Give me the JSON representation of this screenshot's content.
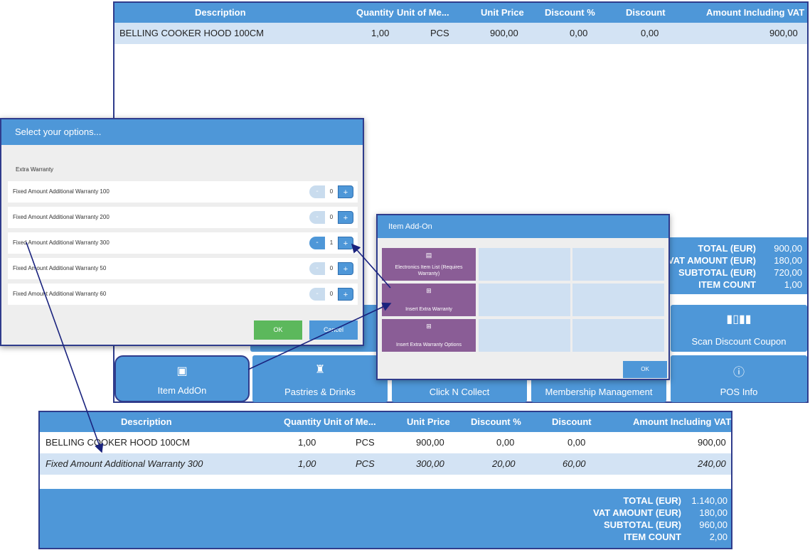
{
  "main_window": {
    "columns": [
      "Description",
      "Quantity",
      "Unit of Me...",
      "Unit Price",
      "Discount %",
      "Discount",
      "Amount Including VAT"
    ],
    "rows": [
      {
        "description": "BELLING COOKER HOOD 100CM",
        "quantity": "1,00",
        "unit": "PCS",
        "unit_price": "900,00",
        "discount_pct": "0,00",
        "discount": "0,00",
        "amount": "900,00"
      }
    ],
    "totals": [
      {
        "label": "TOTAL (EUR)",
        "value": "900,00"
      },
      {
        "label": "VAT AMOUNT (EUR)",
        "value": "180,00"
      },
      {
        "label": "SUBTOTAL (EUR)",
        "value": "720,00"
      },
      {
        "label": "ITEM COUNT",
        "value": "1,00"
      }
    ],
    "tiles": {
      "scan_discount_coupon": "Scan Discount Coupon",
      "item_addon": "Item AddOn",
      "pastries_drinks": "Pastries & Drinks",
      "click_n_collect": "Click N Collect",
      "membership_management": "Membership Management",
      "pos_info": "POS Info"
    }
  },
  "options_dialog": {
    "title": "Select your options...",
    "group_label": "Extra Warranty",
    "options": [
      {
        "label": "Fixed Amount Additional Warranty 100",
        "qty": "0",
        "minus": "-",
        "plus": "+"
      },
      {
        "label": "Fixed Amount Additional Warranty 200",
        "qty": "0",
        "minus": "-",
        "plus": "+"
      },
      {
        "label": "Fixed Amount Additional Warranty 300",
        "qty": "1",
        "minus": "-",
        "plus": "+"
      },
      {
        "label": "Fixed Amount Additional Warranty 50",
        "qty": "0",
        "minus": "-",
        "plus": "+"
      },
      {
        "label": "Fixed Amount Additional Warranty 60",
        "qty": "0",
        "minus": "-",
        "plus": "+"
      }
    ],
    "ok_label": "OK",
    "cancel_label": "Cancel"
  },
  "addon_dialog": {
    "title": "Item Add-On",
    "tiles": [
      {
        "label": "Electronics Item List (Requires Warranty)"
      },
      {
        "label": "Insert Extra Warranty"
      },
      {
        "label": "Insert Extra Warranty Options"
      }
    ],
    "ok_label": "OK"
  },
  "result_window": {
    "columns": [
      "Description",
      "Quantity",
      "Unit of Me...",
      "Unit Price",
      "Discount %",
      "Discount",
      "Amount Including VAT"
    ],
    "rows": [
      {
        "description": "BELLING COOKER HOOD 100CM",
        "quantity": "1,00",
        "unit": "PCS",
        "unit_price": "900,00",
        "discount_pct": "0,00",
        "discount": "0,00",
        "amount": "900,00"
      },
      {
        "description": "Fixed Amount Additional Warranty 300",
        "quantity": "1,00",
        "unit": "PCS",
        "unit_price": "300,00",
        "discount_pct": "20,00",
        "discount": "60,00",
        "amount": "240,00"
      }
    ],
    "totals": [
      {
        "label": "TOTAL (EUR)",
        "value": "1.140,00"
      },
      {
        "label": "VAT AMOUNT (EUR)",
        "value": "180,00"
      },
      {
        "label": "SUBTOTAL (EUR)",
        "value": "960,00"
      },
      {
        "label": "ITEM COUNT",
        "value": "2,00"
      }
    ]
  },
  "colors": {
    "accent": "#4e97d8",
    "addon_tile": "#8a5d96",
    "selected_row": "#d3e3f4",
    "annotation": "#2f3c8c",
    "ok_green": "#5cb85c"
  }
}
